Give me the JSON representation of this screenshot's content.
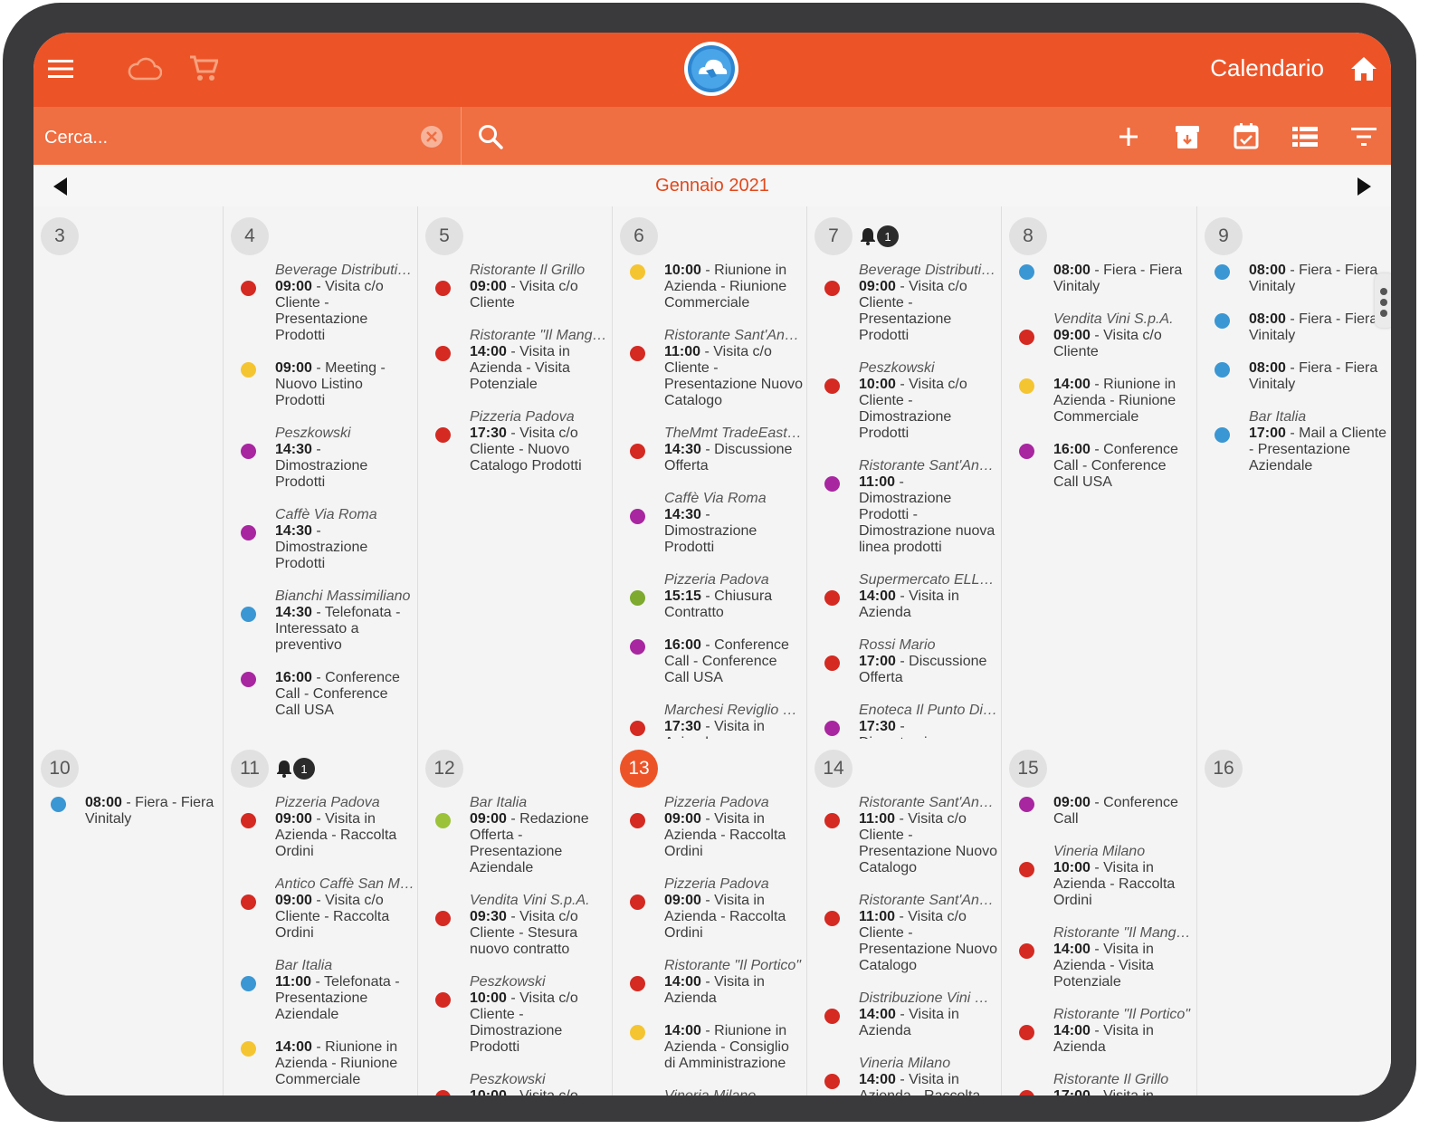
{
  "header": {
    "title": "Calendario"
  },
  "search": {
    "placeholder": "Cerca..."
  },
  "month": {
    "label": "Gennaio 2021"
  },
  "colors": {
    "accent": "#ec5428",
    "red": "#d42a22",
    "yellow": "#f5c531",
    "purple": "#a826a0",
    "blue": "#3a97d3",
    "green": "#7daa2f",
    "lightgreen": "#9cc23a"
  },
  "weeks": [
    [
      {
        "num": "3",
        "events": []
      },
      {
        "num": "4",
        "events": [
          {
            "client": "Beverage Distributio...",
            "time": "09:00",
            "text": " - Visita c/o Cliente - Presentazione Prodotti",
            "color": "red"
          },
          {
            "time": "09:00",
            "text": " - Meeting - Nuovo Listino Prodotti",
            "color": "yellow"
          },
          {
            "client": "Peszkowski",
            "time": "14:30",
            "text": " - Dimostrazione Prodotti",
            "color": "purple"
          },
          {
            "client": "Caffè Via Roma",
            "time": "14:30",
            "text": " - Dimostrazione Prodotti",
            "color": "purple"
          },
          {
            "client": "Bianchi Massimiliano",
            "time": "14:30",
            "text": " - Telefonata - Interessato a preventivo",
            "color": "blue"
          },
          {
            "time": "16:00",
            "text": " - Conference Call - Conference Call USA",
            "color": "purple"
          }
        ]
      },
      {
        "num": "5",
        "events": [
          {
            "client": "Ristorante Il Grillo",
            "time": "09:00",
            "text": " - Visita c/o Cliente",
            "color": "red"
          },
          {
            "client": "Ristorante \"Il Mangio...",
            "time": "14:00",
            "text": " - Visita in Azienda - Visita Potenziale",
            "color": "red"
          },
          {
            "client": "Pizzeria Padova",
            "time": "17:30",
            "text": " - Visita c/o Cliente - Nuovo Catalogo Prodotti",
            "color": "red"
          }
        ]
      },
      {
        "num": "6",
        "events": [
          {
            "time": "10:00",
            "text": " - Riunione in Azienda - Riunione Commerciale",
            "color": "yellow"
          },
          {
            "client": "Ristorante Sant'Andr...",
            "time": "11:00",
            "text": " - Visita c/o Cliente - Presentazione Nuovo Catalogo",
            "color": "red"
          },
          {
            "client": "TheMmt TradeEast S...",
            "time": "14:30",
            "text": " - Discussione Offerta",
            "color": "red"
          },
          {
            "client": "Caffè Via Roma",
            "time": "14:30",
            "text": " - Dimostrazione Prodotti",
            "color": "purple"
          },
          {
            "client": "Pizzeria Padova",
            "time": "15:15",
            "text": " - Chiusura Contratto",
            "color": "green"
          },
          {
            "time": "16:00",
            "text": " - Conference Call - Conference Call USA",
            "color": "purple"
          },
          {
            "client": "Marchesi Reviglio S.r.l.",
            "time": "17:30",
            "text": " - Visita in Azienda",
            "color": "red"
          }
        ]
      },
      {
        "num": "7",
        "badge": "1",
        "events": [
          {
            "client": "Beverage Distributio...",
            "time": "09:00",
            "text": " - Visita c/o Cliente - Presentazione Prodotti",
            "color": "red"
          },
          {
            "client": "Peszkowski",
            "time": "10:00",
            "text": " - Visita c/o Cliente - Dimostrazione Prodotti",
            "color": "red"
          },
          {
            "client": "Ristorante Sant'Andr...",
            "time": "11:00",
            "text": " - Dimostrazione Prodotti - Dimostrazione nuova linea prodotti",
            "color": "purple"
          },
          {
            "client": "Supermercato ELLES...",
            "time": "14:00",
            "text": " - Visita in Azienda",
            "color": "red"
          },
          {
            "client": "Rossi Mario",
            "time": "17:00",
            "text": " - Discussione Offerta",
            "color": "red"
          },
          {
            "client": "Enoteca Il Punto Di V...",
            "time": "17:30",
            "text": " - Dimostrazione Prodotti",
            "color": "purple"
          }
        ]
      },
      {
        "num": "8",
        "events": [
          {
            "time": "08:00",
            "text": " - Fiera - Fiera Vinitaly",
            "color": "blue"
          },
          {
            "client": "Vendita Vini S.p.A.",
            "time": "09:00",
            "text": " - Visita c/o Cliente",
            "color": "red"
          },
          {
            "time": "14:00",
            "text": " - Riunione in Azienda - Riunione Commerciale",
            "color": "yellow"
          },
          {
            "time": "16:00",
            "text": " - Conference Call - Conference Call USA",
            "color": "purple"
          }
        ]
      },
      {
        "num": "9",
        "events": [
          {
            "time": "08:00",
            "text": " - Fiera - Fiera Vinitaly",
            "color": "blue"
          },
          {
            "time": "08:00",
            "text": " - Fiera - Fiera Vinitaly",
            "color": "blue"
          },
          {
            "time": "08:00",
            "text": " - Fiera - Fiera Vinitaly",
            "color": "blue"
          },
          {
            "client": "Bar Italia",
            "time": "17:00",
            "text": " - Mail a Cliente - Presentazione Aziendale",
            "color": "blue"
          }
        ]
      }
    ],
    [
      {
        "num": "10",
        "events": [
          {
            "time": "08:00",
            "text": " - Fiera - Fiera Vinitaly",
            "color": "blue"
          }
        ]
      },
      {
        "num": "11",
        "badge": "1",
        "events": [
          {
            "client": "Pizzeria Padova",
            "time": "09:00",
            "text": " - Visita in Azienda - Raccolta Ordini",
            "color": "red"
          },
          {
            "client": "Antico Caffè San Mar...",
            "time": "09:00",
            "text": " - Visita c/o Cliente - Raccolta Ordini",
            "color": "red"
          },
          {
            "client": "Bar Italia",
            "time": "11:00",
            "text": " - Telefonata - Presentazione Aziendale",
            "color": "blue"
          },
          {
            "time": "14:00",
            "text": " - Riunione in Azienda - Riunione Commerciale",
            "color": "yellow"
          }
        ]
      },
      {
        "num": "12",
        "events": [
          {
            "client": "Bar Italia",
            "time": "09:00",
            "text": " - Redazione Offerta - Presentazione Aziendale",
            "color": "lightgreen"
          },
          {
            "client": "Vendita Vini S.p.A.",
            "time": "09:30",
            "text": " - Visita c/o Cliente - Stesura nuovo contratto",
            "color": "red"
          },
          {
            "client": "Peszkowski",
            "time": "10:00",
            "text": " - Visita c/o Cliente - Dimostrazione Prodotti",
            "color": "red"
          },
          {
            "client": "Peszkowski",
            "time": "10:00",
            "text": " - Visita c/o Cliente -",
            "color": "red"
          }
        ]
      },
      {
        "num": "13",
        "today": true,
        "events": [
          {
            "client": "Pizzeria Padova",
            "time": "09:00",
            "text": " - Visita in Azienda - Raccolta Ordini",
            "color": "red"
          },
          {
            "client": "Pizzeria Padova",
            "time": "09:00",
            "text": " - Visita in Azienda - Raccolta Ordini",
            "color": "red"
          },
          {
            "client": "Ristorante \"Il Portico\"",
            "time": "14:00",
            "text": " - Visita in Azienda",
            "color": "red"
          },
          {
            "time": "14:00",
            "text": " - Riunione in Azienda - Consiglio di Amministrazione",
            "color": "yellow"
          },
          {
            "client": "Vineria Milano",
            "time": "14:00",
            "text": " - Visita in",
            "color": "red"
          }
        ]
      },
      {
        "num": "14",
        "events": [
          {
            "client": "Ristorante Sant'Andr...",
            "time": "11:00",
            "text": " - Visita c/o Cliente - Presentazione Nuovo Catalogo",
            "color": "red"
          },
          {
            "client": "Ristorante Sant'Andr...",
            "time": "11:00",
            "text": " - Visita c/o Cliente - Presentazione Nuovo Catalogo",
            "color": "red"
          },
          {
            "client": "Distribuzione Vini S.p...",
            "time": "14:00",
            "text": " - Visita in Azienda",
            "color": "red"
          },
          {
            "client": "Vineria Milano",
            "time": "14:00",
            "text": " - Visita in Azienda - Raccolta Ordini",
            "color": "red"
          }
        ]
      },
      {
        "num": "15",
        "events": [
          {
            "time": "09:00",
            "text": " - Conference Call",
            "color": "purple"
          },
          {
            "client": "Vineria Milano",
            "time": "10:00",
            "text": " - Visita in Azienda - Raccolta Ordini",
            "color": "red"
          },
          {
            "client": "Ristorante \"Il Mangio...",
            "time": "14:00",
            "text": " - Visita in Azienda - Visita Potenziale",
            "color": "red"
          },
          {
            "client": "Ristorante \"Il Portico\"",
            "time": "14:00",
            "text": " - Visita in Azienda",
            "color": "red"
          },
          {
            "client": "Ristorante Il Grillo",
            "time": "17:00",
            "text": " - Visita in",
            "color": "red"
          }
        ]
      },
      {
        "num": "16",
        "events": []
      }
    ]
  ]
}
